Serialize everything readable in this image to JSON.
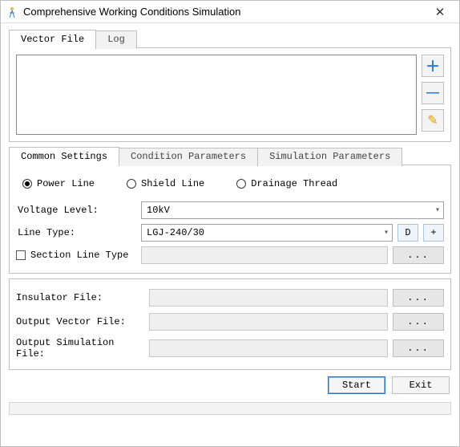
{
  "window": {
    "title": "Comprehensive Working Conditions Simulation",
    "close_glyph": "✕"
  },
  "vectorTabs": {
    "vectorFile": "Vector File",
    "log": "Log"
  },
  "vfButtons": {
    "add_glyph": "＋",
    "remove_glyph": "—",
    "edit_glyph": "✎"
  },
  "settingsTabs": {
    "common": "Common Settings",
    "condition": "Condition Parameters",
    "simulation": "Simulation Parameters"
  },
  "lineTypeRadios": {
    "power": "Power Line",
    "shield": "Shield Line",
    "drainage": "Drainage Thread",
    "selected": "power"
  },
  "form": {
    "voltageLabel": "Voltage Level:",
    "voltageValue": "10kV",
    "lineTypeLabel": "Line Type:",
    "lineTypeValue": "LGJ-240/30",
    "dButton": "D",
    "plusButton": "+",
    "sectionLabel": "Section Line Type",
    "sectionBrowse": "..."
  },
  "files": {
    "insulatorLabel": "Insulator File:",
    "outputVectorLabel": "Output Vector File:",
    "outputSimLabel": "Output Simulation File:",
    "browse": "..."
  },
  "footer": {
    "start": "Start",
    "exit": "Exit"
  },
  "colors": {
    "addIcon": "#2f7dd1",
    "removeIcon": "#2f7dd1",
    "editIcon": "#d99b1e"
  }
}
